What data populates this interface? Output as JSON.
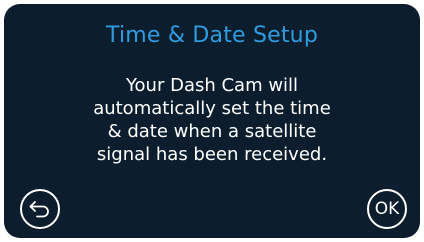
{
  "screen": {
    "title": "Time & Date Setup",
    "message_lines": [
      "Your Dash Cam will",
      "automatically set the time",
      "& date when a satellite",
      "signal has been received."
    ]
  },
  "buttons": {
    "back_icon": "back-arrow-icon",
    "ok_label": "OK"
  },
  "colors": {
    "background": "#0c1e2e",
    "title": "#2f9ce0",
    "text": "#ffffff"
  }
}
